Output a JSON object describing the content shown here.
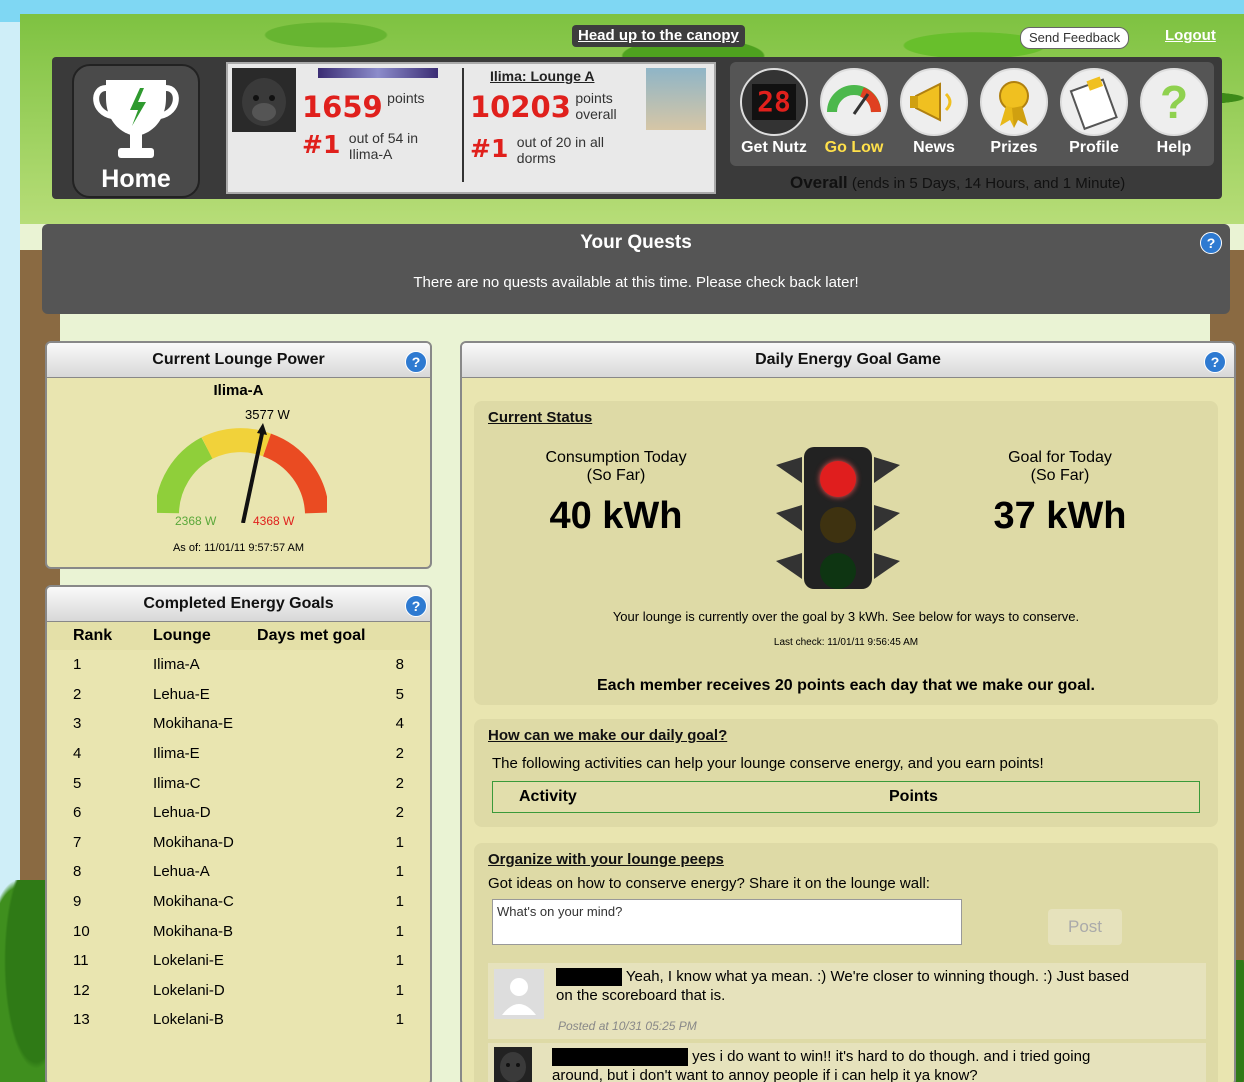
{
  "topbar": {
    "canopy_link": "Head up to the canopy",
    "feedback": "Send Feedback",
    "logout": "Logout"
  },
  "home": {
    "label": "Home"
  },
  "score": {
    "user_points": "1659",
    "user_points_label": "points",
    "user_rank": "#1",
    "user_rank_text": "out of 54 in",
    "user_rank_text2": "Ilima-A",
    "lounge_title": "Ilima: Lounge A",
    "lounge_points": "10203",
    "lounge_points_label": "points",
    "lounge_points_label2": "overall",
    "lounge_rank": "#1",
    "lounge_rank_text": "out of 20 in all",
    "lounge_rank_text2": "dorms"
  },
  "nav": {
    "items": [
      {
        "label": "Get Nutz",
        "icon": "counter-icon",
        "counter": "28"
      },
      {
        "label": "Go Low",
        "icon": "gauge-icon",
        "active": true
      },
      {
        "label": "News",
        "icon": "megaphone-icon"
      },
      {
        "label": "Prizes",
        "icon": "ribbon-icon"
      },
      {
        "label": "Profile",
        "icon": "profile-card-icon"
      },
      {
        "label": "Help",
        "icon": "question-icon",
        "symbol": "?"
      }
    ],
    "overall_label": "Overall",
    "overall_text": "(ends in 5 Days, 14 Hours, and 1 Minute)"
  },
  "quests": {
    "title": "Your Quests",
    "message": "There are no quests available at this time. Please check back later!",
    "help": "?"
  },
  "lounge_power": {
    "title": "Current Lounge Power",
    "lounge": "Ilima-A",
    "current": "3577 W",
    "min": "2368 W",
    "max": "4368 W",
    "as_of": "As of: 11/01/11 9:57:57 AM",
    "help": "?"
  },
  "completed_goals": {
    "title": "Completed Energy Goals",
    "help": "?",
    "headers": [
      "Rank",
      "Lounge",
      "Days met goal"
    ],
    "rows": [
      [
        "1",
        "Ilima-A",
        "8"
      ],
      [
        "2",
        "Lehua-E",
        "5"
      ],
      [
        "3",
        "Mokihana-E",
        "4"
      ],
      [
        "4",
        "Ilima-E",
        "2"
      ],
      [
        "5",
        "Ilima-C",
        "2"
      ],
      [
        "6",
        "Lehua-D",
        "2"
      ],
      [
        "7",
        "Mokihana-D",
        "1"
      ],
      [
        "8",
        "Lehua-A",
        "1"
      ],
      [
        "9",
        "Mokihana-C",
        "1"
      ],
      [
        "10",
        "Mokihana-B",
        "1"
      ],
      [
        "11",
        "Lokelani-E",
        "1"
      ],
      [
        "12",
        "Lokelani-D",
        "1"
      ],
      [
        "13",
        "Lokelani-B",
        "1"
      ]
    ]
  },
  "game": {
    "title": "Daily Energy Goal Game",
    "help": "?",
    "status_title": "Current Status",
    "consumption_label": "Consumption Today",
    "consumption_label2": "(So Far)",
    "consumption_value": "40 kWh",
    "goal_label": "Goal for Today",
    "goal_label2": "(So Far)",
    "goal_value": "37 kWh",
    "status_msg": "Your lounge is currently over the goal by 3 kWh. See below for ways to conserve.",
    "last_check": "Last check: 11/01/11 9:56:45 AM",
    "reward_msg": "Each member receives 20 points each day that we make our goal.",
    "how_title": "How can we make our daily goal?",
    "how_text": "The following activities can help your lounge conserve energy, and you earn points!",
    "activity_header": "Activity",
    "points_header": "Points",
    "organize_title": "Organize with your lounge peeps",
    "organize_text": "Got ideas on how to conserve energy? Share it on the lounge wall:",
    "mind_placeholder": "What's on your mind?",
    "post_label": "Post",
    "comments": [
      {
        "text": "Yeah, I know what ya mean. :) We're closer to winning though. :) Just based",
        "text2": "on the scoreboard that is.",
        "posted": "Posted at 10/31 05:25 PM"
      },
      {
        "text": "yes i do want to win!! it's hard to do though. and i tried going",
        "text2": "around, but i don't want to annoy people if i can help it ya know?"
      }
    ]
  }
}
